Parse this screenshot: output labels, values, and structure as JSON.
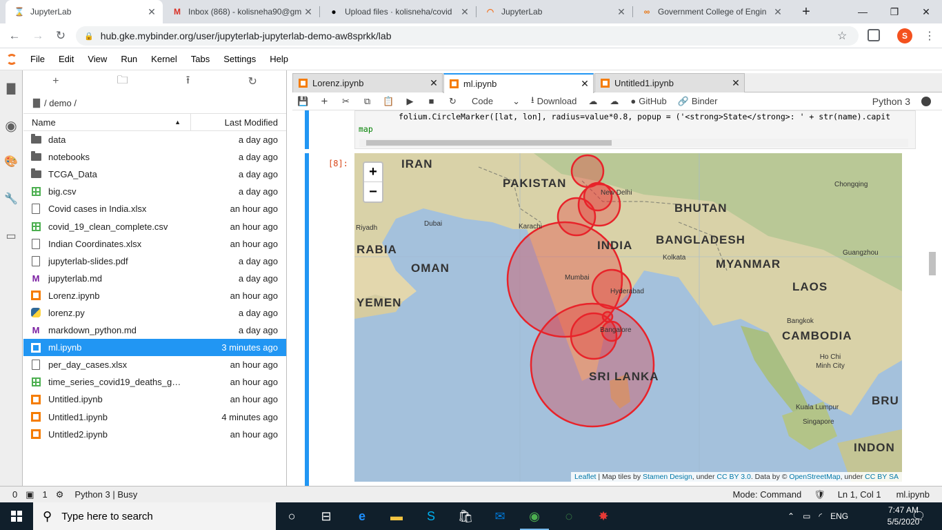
{
  "browser": {
    "tabs": [
      {
        "title": "JupyterLab",
        "icon": "jupyter-hourglass-icon"
      },
      {
        "title": "Inbox (868) - kolisneha90@gm",
        "icon": "gmail-icon"
      },
      {
        "title": "Upload files · kolisneha/covid",
        "icon": "github-icon"
      },
      {
        "title": "JupyterLab",
        "icon": "jupyter-icon"
      },
      {
        "title": "Government College of Engin",
        "icon": "colab-icon"
      }
    ],
    "new_tab": "+",
    "url": "hub.gke.mybinder.org/user/jupyterlab-jupyterlab-demo-aw8sprkk/lab",
    "profile_initial": "S",
    "window_controls": [
      "—",
      "❐",
      "✕"
    ]
  },
  "menu": [
    "File",
    "Edit",
    "View",
    "Run",
    "Kernel",
    "Tabs",
    "Settings",
    "Help"
  ],
  "filebrowser": {
    "path": "/ demo /",
    "col_name": "Name",
    "col_modified": "Last Modified",
    "files": [
      {
        "name": "data",
        "type": "folder",
        "modified": "a day ago"
      },
      {
        "name": "notebooks",
        "type": "folder",
        "modified": "a day ago"
      },
      {
        "name": "TCGA_Data",
        "type": "folder",
        "modified": "a day ago"
      },
      {
        "name": "big.csv",
        "type": "csv",
        "modified": "a day ago"
      },
      {
        "name": "Covid cases in India.xlsx",
        "type": "file",
        "modified": "an hour ago"
      },
      {
        "name": "covid_19_clean_complete.csv",
        "type": "csv",
        "modified": "an hour ago"
      },
      {
        "name": "Indian Coordinates.xlsx",
        "type": "file",
        "modified": "an hour ago"
      },
      {
        "name": "jupyterlab-slides.pdf",
        "type": "file",
        "modified": "a day ago"
      },
      {
        "name": "jupyterlab.md",
        "type": "md",
        "modified": "a day ago"
      },
      {
        "name": "Lorenz.ipynb",
        "type": "nb",
        "modified": "an hour ago"
      },
      {
        "name": "lorenz.py",
        "type": "py",
        "modified": "a day ago"
      },
      {
        "name": "markdown_python.md",
        "type": "md",
        "modified": "a day ago"
      },
      {
        "name": "ml.ipynb",
        "type": "nb",
        "modified": "3 minutes ago",
        "selected": true
      },
      {
        "name": "per_day_cases.xlsx",
        "type": "file",
        "modified": "an hour ago"
      },
      {
        "name": "time_series_covid19_deaths_glob...",
        "type": "csv",
        "modified": "an hour ago"
      },
      {
        "name": "Untitled.ipynb",
        "type": "nb",
        "modified": "an hour ago"
      },
      {
        "name": "Untitled1.ipynb",
        "type": "nb",
        "modified": "4 minutes ago"
      },
      {
        "name": "Untitled2.ipynb",
        "type": "nb",
        "modified": "an hour ago"
      }
    ]
  },
  "doc_tabs": [
    "Lorenz.ipynb",
    "ml.ipynb",
    "Untitled1.ipynb"
  ],
  "nb_toolbar": {
    "cell_type": "Code",
    "download": "Download",
    "github": "GitHub",
    "binder": "Binder",
    "kernel": "Python 3"
  },
  "code": {
    "line1": "folium.CircleMarker([lat, lon], radius=value*0.8, popup = ('<strong>State</strong>: ' + str(name).capit",
    "line2": "map"
  },
  "output_prompt": "[8]:",
  "map": {
    "labels": [
      "IRAN",
      "PAKISTAN",
      "BHUTAN",
      "INDIA",
      "BANGLADESH",
      "RABIA",
      "OMAN",
      "MYANMAR",
      "LAOS",
      "YEMEN",
      "CAMBODIA",
      "SRI LANKA",
      "BRU",
      "INDON"
    ],
    "cities": [
      "Riyadh",
      "Dubai",
      "Karachi",
      "New Delhi",
      "Kolkata",
      "Mumbai",
      "Hyderabad",
      "Bangalore",
      "Chongqing",
      "Guangzhou",
      "Bangkok",
      "Ho Chi Minh City",
      "Kuala Lumpur",
      "Singapore"
    ],
    "zoom_in": "+",
    "zoom_out": "−",
    "attribution": {
      "leaflet": "Leaflet",
      "mid": " | Map tiles by ",
      "stamen": "Stamen Design",
      "under": ", under ",
      "ccby3": "CC BY 3.0",
      "data": ". Data by © ",
      "osm": "OpenStreetMap",
      "under2": ", under ",
      "ccbysa": "CC BY SA"
    },
    "marker_color": "#e8232a"
  },
  "statusbar": {
    "terminals": "0",
    "kernels": "1",
    "kernel_status": "Python 3 | Busy",
    "mode": "Mode: Command",
    "position": "Ln 1, Col 1",
    "file": "ml.ipynb"
  },
  "taskbar": {
    "search_placeholder": "Type here to search",
    "lang": "ENG",
    "time": "7:47 AM",
    "date": "5/5/2020"
  }
}
